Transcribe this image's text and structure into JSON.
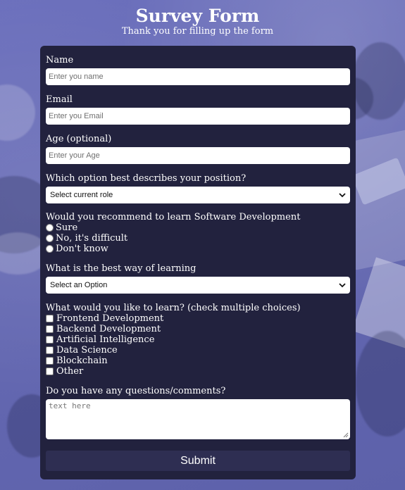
{
  "header": {
    "title": "Survey Form",
    "subtitle": "Thank you for filling up the form"
  },
  "form": {
    "name": {
      "label": "Name",
      "placeholder": "Enter you name",
      "value": ""
    },
    "email": {
      "label": "Email",
      "placeholder": "Enter you Email",
      "value": ""
    },
    "age": {
      "label": "Age (optional)",
      "placeholder": "Enter your Age",
      "value": ""
    },
    "role": {
      "label": "Which option best describes your position?",
      "selected": "Select current role"
    },
    "recommend": {
      "label": "Would you recommend to learn Software Development",
      "options": [
        "Sure",
        "No, it's difficult",
        "Don't know"
      ]
    },
    "learning_way": {
      "label": "What is the best way of learning",
      "selected": "Select an Option"
    },
    "interests": {
      "label": "What would you like to learn? (check multiple choices)",
      "options": [
        "Frontend Development",
        "Backend Development",
        "Artificial Intelligence",
        "Data Science",
        "Blockchain",
        "Other"
      ]
    },
    "comments": {
      "label": "Do you have any questions/comments?",
      "placeholder": "text here",
      "value": ""
    },
    "submit_label": "Submit"
  },
  "icons": {
    "select_arrow": "chevron-down-icon",
    "textarea_resize": "resize-grip-icon"
  },
  "colors": {
    "page_background": "#6b6eb8",
    "form_background": "#22223e",
    "submit_background": "#2e2e52",
    "text": "#ffffff"
  }
}
